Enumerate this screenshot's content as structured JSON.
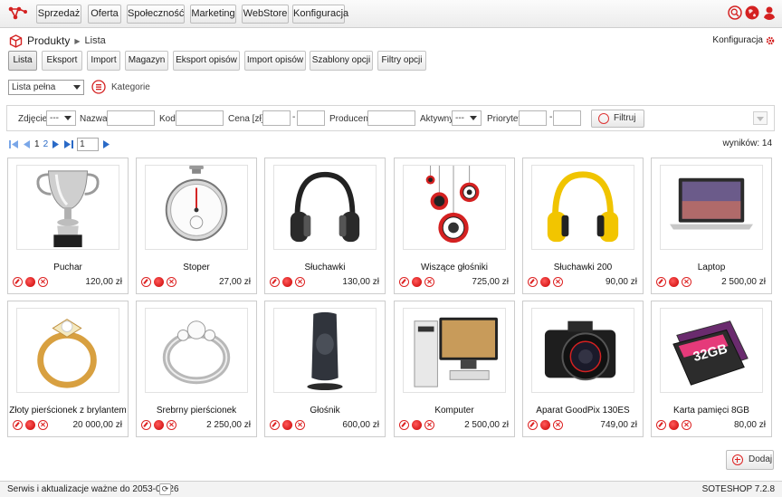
{
  "nav": {
    "items": [
      {
        "label": "Sprzedaż"
      },
      {
        "label": "Oferta"
      },
      {
        "label": "Społeczność"
      },
      {
        "label": "Marketing"
      },
      {
        "label": "WebStore"
      },
      {
        "label": "Konfiguracja"
      }
    ]
  },
  "breadcrumb": {
    "section": "Produkty",
    "page": "Lista"
  },
  "config_link": "Konfiguracja",
  "subtabs": [
    {
      "label": "Lista"
    },
    {
      "label": "Eksport"
    },
    {
      "label": "Import"
    },
    {
      "label": "Magazyn"
    },
    {
      "label": "Eksport opisów"
    },
    {
      "label": "Import opisów"
    },
    {
      "label": "Szablony opcji"
    },
    {
      "label": "Filtry opcji"
    }
  ],
  "list_select": "Lista pełna",
  "categories_label": "Kategorie",
  "filters": {
    "zdjecie_label": "Zdjęcie",
    "zdjecie_value": "---",
    "nazwa_label": "Nazwa",
    "kod_label": "Kod",
    "cena_label": "Cena [zł]",
    "producent_label": "Producent",
    "aktywny_label": "Aktywny",
    "aktywny_value": "---",
    "priorytet_label": "Priorytet",
    "dash": "-",
    "submit_label": "Filtruj"
  },
  "pager": {
    "page1": "1",
    "page2": "2",
    "current": "1"
  },
  "results": "wyników: 14",
  "products": [
    {
      "name": "Puchar",
      "price": "120,00 zł"
    },
    {
      "name": "Stoper",
      "price": "27,00 zł"
    },
    {
      "name": "Słuchawki",
      "price": "130,00 zł"
    },
    {
      "name": "Wiszące głośniki",
      "price": "725,00 zł"
    },
    {
      "name": "Słuchawki 200",
      "price": "90,00 zł"
    },
    {
      "name": "Laptop",
      "price": "2 500,00 zł"
    },
    {
      "name": "Złoty pierścionek z brylantem",
      "price": "20 000,00 zł"
    },
    {
      "name": "Srebrny pierścionek",
      "price": "2 250,00 zł"
    },
    {
      "name": "Głośnik",
      "price": "600,00 zł"
    },
    {
      "name": "Komputer",
      "price": "2 500,00 zł"
    },
    {
      "name": "Aparat GoodPix 130ES",
      "price": "749,00 zł"
    },
    {
      "name": "Karta pamięci 8GB",
      "price": "80,00 zł"
    }
  ],
  "card_text": {
    "memory_card_capacity": "32GB"
  },
  "add_button": "Dodaj",
  "footer": {
    "service_text": "Serwis i aktualizacje ważne do 2053-08-26",
    "version": "SOTESHOP 7.2.8"
  },
  "colors": {
    "accent": "#d42121",
    "link": "#2a6ac7"
  }
}
